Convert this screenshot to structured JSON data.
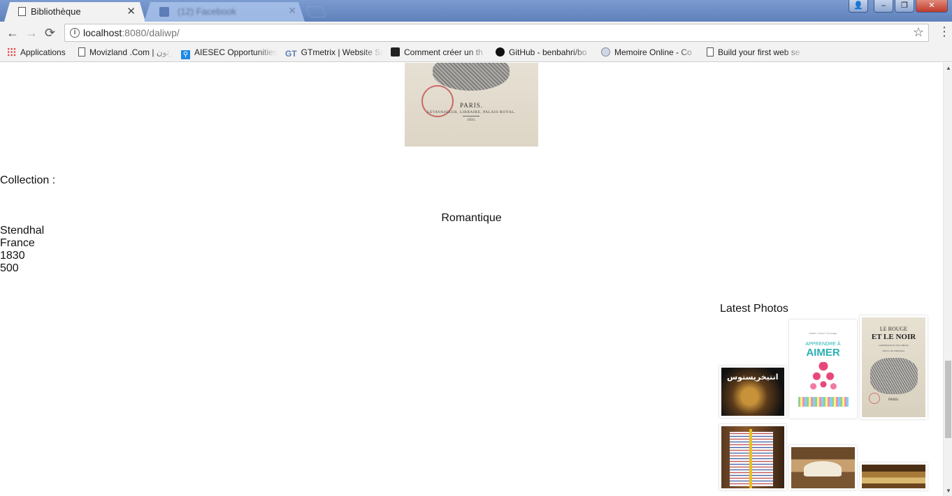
{
  "browser": {
    "active_tab": {
      "title": "Bibliothèque",
      "close": "✕"
    },
    "background_tab": {
      "title": "(12) Facebook",
      "close": "✕"
    },
    "window_controls": {
      "user": "👤",
      "minimize": "–",
      "maximize": "❐",
      "close": "✕"
    },
    "nav": {
      "back": "←",
      "forward": "→",
      "reload": "⟳"
    },
    "address": {
      "host": "localhost",
      "path": ":8080/daliwp/",
      "info": "i",
      "star": "☆"
    },
    "menu": "⋮",
    "bookmarks": [
      {
        "label": "Applications",
        "icon": "apps-grid-icon"
      },
      {
        "label": "Movizland .Com | رتون",
        "icon": "page-icon"
      },
      {
        "label": "AIESEC Opportunities",
        "icon": "aiesec-icon"
      },
      {
        "label": "GTmetrix | Website Sp",
        "icon": "gtmetrix-icon"
      },
      {
        "label": "Comment créer un th",
        "icon": "wordpress-icon"
      },
      {
        "label": "GitHub - benbahri/bo",
        "icon": "github-icon"
      },
      {
        "label": "Memoire Online - Co",
        "icon": "memoire-icon"
      },
      {
        "label": "Build your first web se",
        "icon": "page-icon"
      }
    ]
  },
  "book": {
    "cover": {
      "city": "PARIS.",
      "publisher": "LEVAVASSEUR, LIBRAIRE, PALAIS-ROYAL.",
      "year": "1831."
    },
    "collection_label": "Collection :",
    "genre": "Romantique",
    "author": "Stendhal",
    "country": "France",
    "year": "1830",
    "pages": "500"
  },
  "sidebar": {
    "title": "Latest Photos",
    "photos": {
      "p1": {
        "text": "انتيخريستوس"
      },
      "p2": {
        "small": "Martin Luther Ouvrage",
        "line1": "APPRENDRE À",
        "line2": "AIMER"
      },
      "p3": {
        "line1": "LE ROUGE",
        "line2": "ET LE NOIR",
        "line3": "CHRONIQUE DU XIXe SIÈCLE",
        "line4": "PAR M. DE STENDHAL",
        "place": "PARIS."
      }
    }
  },
  "scrollbar": {
    "up": "▲",
    "down": "▼",
    "thumb_position": 0.72
  }
}
